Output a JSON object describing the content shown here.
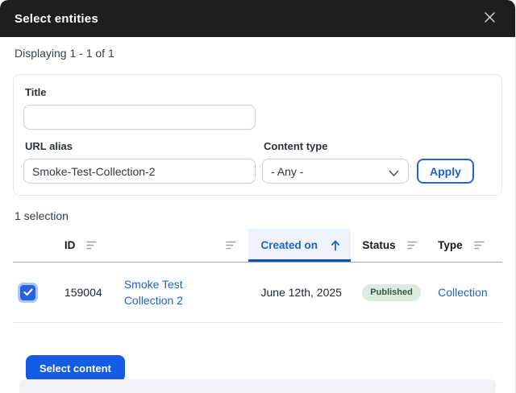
{
  "modal": {
    "title": "Select entities"
  },
  "summary": {
    "displaying": "Displaying 1 - 1 of 1",
    "selection_count": "1 selection"
  },
  "filters": {
    "title_label": "Title",
    "title_value": "",
    "url_alias_label": "URL alias",
    "url_alias_value": "Smoke-Test-Collection-2",
    "content_type_label": "Content type",
    "content_type_value": "- Any -",
    "apply_label": "Apply"
  },
  "table": {
    "columns": [
      {
        "label": "ID",
        "sortable": true
      },
      {
        "label": "",
        "sortable": true
      },
      {
        "label": "Created on",
        "sortable": true,
        "active": true,
        "sort_direction": "asc"
      },
      {
        "label": "Status",
        "sortable": true
      },
      {
        "label": "Type",
        "sortable": true
      }
    ],
    "rows": [
      {
        "selected": true,
        "id": "159004",
        "title": "Smoke Test Collection 2",
        "created_on": "June 12th, 2025",
        "status": "Published",
        "type": "Collection"
      }
    ]
  },
  "actions": {
    "select_content_label": "Select content"
  },
  "icons": {
    "close": "close-icon",
    "sort": "sort-lines-icon",
    "arrow_up": "arrow-up-icon",
    "chevron_down": "chevron-down-icon",
    "check": "check-icon"
  },
  "colors": {
    "header_bg": "#1e1e21",
    "accent_blue": "#155ce4",
    "link_blue": "#2062cc",
    "active_column_bg": "#eef3fb",
    "active_column_underline": "#1b4fad",
    "badge_bg": "#d9ecdf",
    "badge_text": "#335841"
  }
}
